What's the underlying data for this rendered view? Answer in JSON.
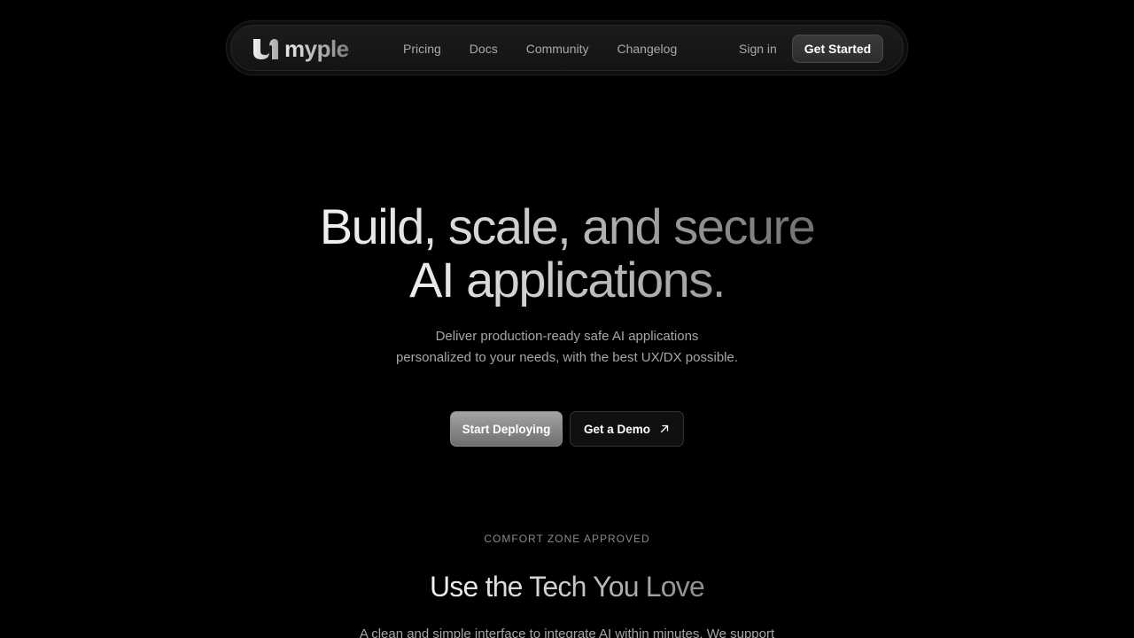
{
  "nav": {
    "brand": "myple",
    "links": [
      "Pricing",
      "Docs",
      "Community",
      "Changelog"
    ],
    "sign_in": "Sign in",
    "cta": "Get Started",
    "logo_icon": "myple-logo-icon"
  },
  "hero": {
    "title_line1": "Build, scale, and secure",
    "title_line2": "AI applications.",
    "subtitle_line1": "Deliver production-ready safe AI applications",
    "subtitle_line2": "personalized to your needs, with the best UX/DX possible.",
    "primary_cta": "Start Deploying",
    "secondary_cta": "Get a Demo",
    "secondary_cta_icon": "arrow-up-right-icon"
  },
  "section": {
    "eyebrow": "COMFORT ZONE APPROVED",
    "title": "Use the Tech You Love",
    "subtitle": "A clean and simple interface to integrate AI within minutes. We support"
  },
  "colors": {
    "background": "#000000",
    "nav_bg": "#161616",
    "text_muted": "#a6a6a6",
    "primary_button": "#8a8a8a"
  }
}
